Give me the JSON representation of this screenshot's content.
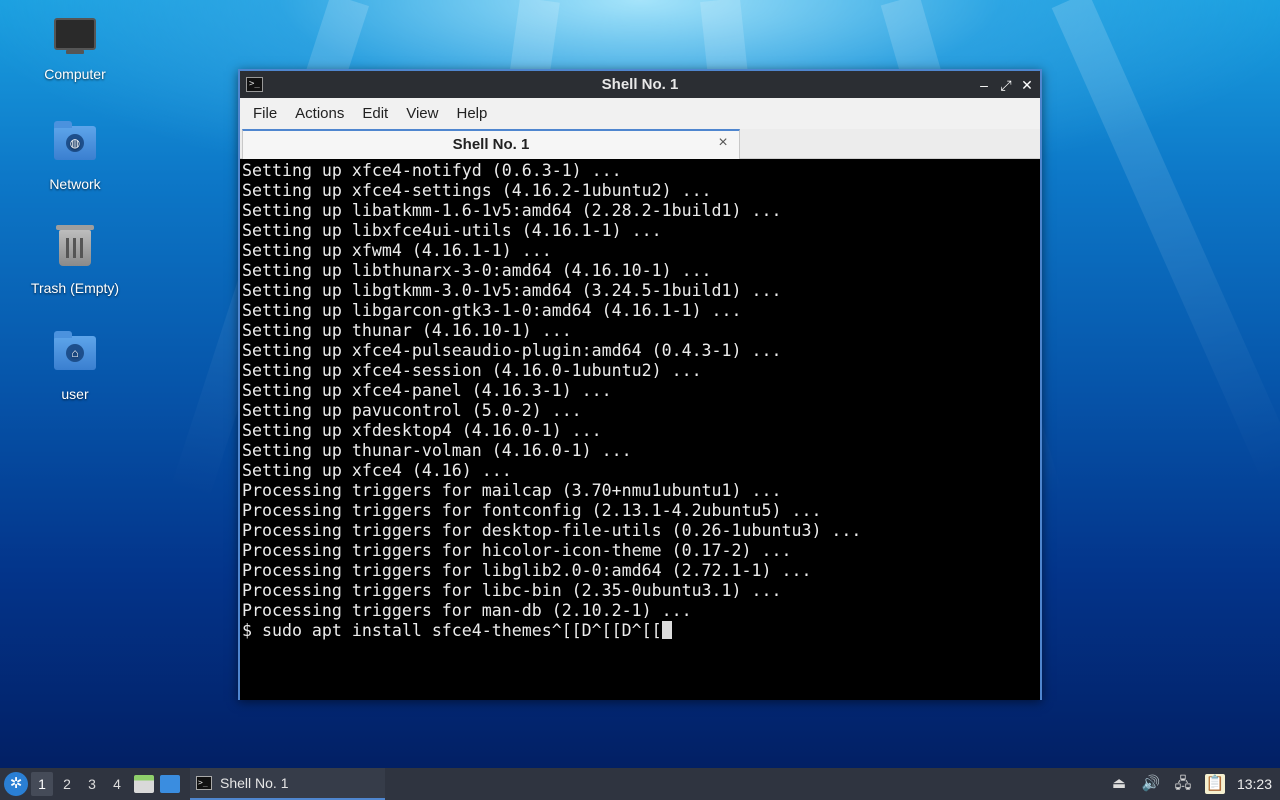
{
  "desktop": {
    "icons": [
      {
        "label": "Computer",
        "icon": "computer-icon"
      },
      {
        "label": "Network",
        "icon": "network-folder-icon"
      },
      {
        "label": "Trash (Empty)",
        "icon": "trash-icon"
      },
      {
        "label": "user",
        "icon": "home-folder-icon"
      }
    ]
  },
  "window": {
    "title": "Shell No. 1",
    "menu": [
      "File",
      "Actions",
      "Edit",
      "View",
      "Help"
    ],
    "tab_label": "Shell No. 1",
    "tab_close": "×",
    "controls": {
      "minimize": "–",
      "maximize": "⤢",
      "close": "✕"
    },
    "terminal": {
      "lines": [
        "Setting up xfce4-notifyd (0.6.3-1) ...",
        "Setting up xfce4-settings (4.16.2-1ubuntu2) ...",
        "Setting up libatkmm-1.6-1v5:amd64 (2.28.2-1build1) ...",
        "Setting up libxfce4ui-utils (4.16.1-1) ...",
        "Setting up xfwm4 (4.16.1-1) ...",
        "Setting up libthunarx-3-0:amd64 (4.16.10-1) ...",
        "Setting up libgtkmm-3.0-1v5:amd64 (3.24.5-1build1) ...",
        "Setting up libgarcon-gtk3-1-0:amd64 (4.16.1-1) ...",
        "Setting up thunar (4.16.10-1) ...",
        "Setting up xfce4-pulseaudio-plugin:amd64 (0.4.3-1) ...",
        "Setting up xfce4-session (4.16.0-1ubuntu2) ...",
        "Setting up xfce4-panel (4.16.3-1) ...",
        "Setting up pavucontrol (5.0-2) ...",
        "Setting up xfdesktop4 (4.16.0-1) ...",
        "Setting up thunar-volman (4.16.0-1) ...",
        "Setting up xfce4 (4.16) ...",
        "Processing triggers for mailcap (3.70+nmu1ubuntu1) ...",
        "Processing triggers for fontconfig (2.13.1-4.2ubuntu5) ...",
        "Processing triggers for desktop-file-utils (0.26-1ubuntu3) ...",
        "Processing triggers for hicolor-icon-theme (0.17-2) ...",
        "Processing triggers for libglib2.0-0:amd64 (2.72.1-1) ...",
        "Processing triggers for libc-bin (2.35-0ubuntu3.1) ...",
        "Processing triggers for man-db (2.10.2-1) ..."
      ],
      "prompt": "$ sudo apt install sfce4-themes^[[D^[[D^[["
    }
  },
  "taskbar": {
    "workspaces": [
      "1",
      "2",
      "3",
      "4"
    ],
    "active_workspace": "1",
    "task_label": "Shell No. 1",
    "clock": "13:23"
  },
  "colors": {
    "accent": "#4f86cf",
    "titlebar": "#2b2e33",
    "terminal_bg": "#000000",
    "terminal_fg": "#ececec",
    "taskbar": "#2f3440"
  }
}
